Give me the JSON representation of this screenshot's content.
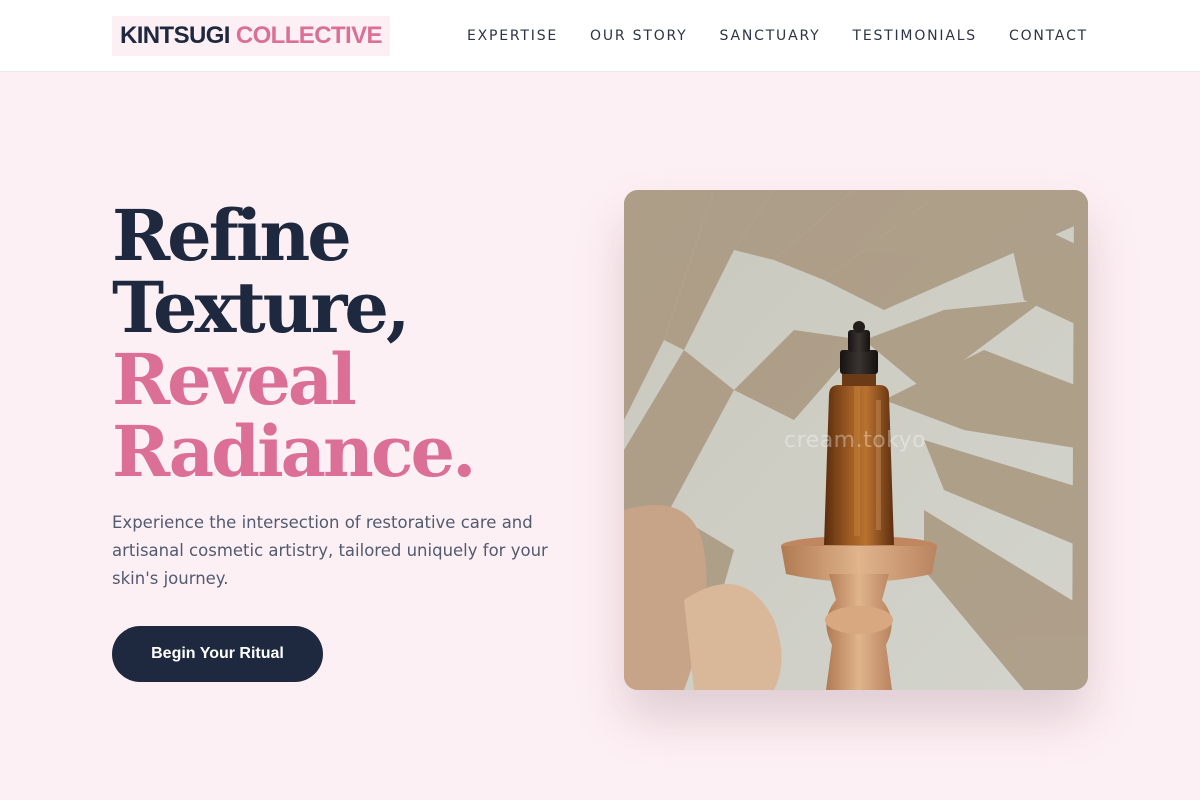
{
  "header": {
    "logo_part1": "KINTSUGI",
    "logo_part2": "COLLECTIVE",
    "nav": [
      {
        "label": "EXPERTISE"
      },
      {
        "label": "OUR STORY"
      },
      {
        "label": "SANCTUARY"
      },
      {
        "label": "TESTIMONIALS"
      },
      {
        "label": "CONTACT"
      }
    ]
  },
  "hero": {
    "title_lines": [
      "Refine",
      "Texture,",
      "Reveal",
      "Radiance."
    ],
    "description": "Experience the intersection of restorative care and artisanal cosmetic artistry, tailored uniquely for your skin's journey.",
    "cta_label": "Begin Your Ritual",
    "image_watermark": "cream.tokyo"
  },
  "colors": {
    "background": "#fdf0f4",
    "navy": "#1e2940",
    "accent_pink": "#db6f96"
  }
}
